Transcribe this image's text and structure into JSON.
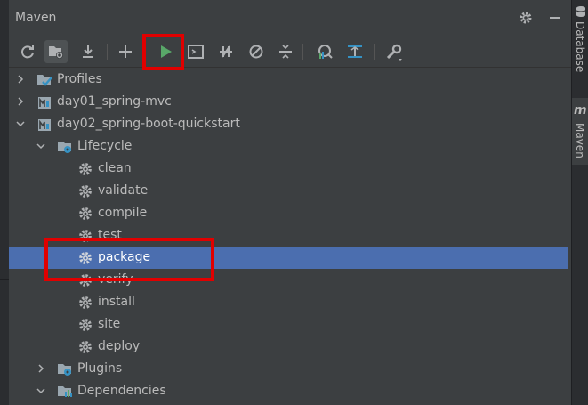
{
  "panel": {
    "title": "Maven",
    "settings_icon": "gear-icon",
    "hide_icon": "minimize-icon"
  },
  "toolbar": {
    "buttons": [
      {
        "name": "reload-all-projects",
        "icon": "refresh-icon"
      },
      {
        "name": "generate-sources",
        "icon": "folder-refresh-icon"
      },
      {
        "name": "download-sources",
        "icon": "download-icon"
      },
      {
        "name": "add-maven-project",
        "icon": "plus-icon"
      },
      {
        "name": "run-maven-build",
        "icon": "play-icon",
        "highlighted": true
      },
      {
        "name": "execute-maven-goal",
        "icon": "terminal-icon"
      },
      {
        "name": "toggle-offline-mode",
        "icon": "offline-icon"
      },
      {
        "name": "toggle-skip-tests",
        "icon": "skip-tests-icon"
      },
      {
        "name": "collapse-all",
        "icon": "collapse-all-icon"
      },
      {
        "name": "show-dependencies",
        "icon": "dependencies-diagram-icon"
      },
      {
        "name": "expand-all",
        "icon": "expand-all-icon"
      },
      {
        "name": "maven-settings",
        "icon": "wrench-icon"
      }
    ]
  },
  "tree": {
    "rows": [
      {
        "label": "Profiles",
        "icon": "profiles-icon",
        "expanded": false
      },
      {
        "label": "day01_spring-mvc",
        "icon": "maven-module-icon",
        "expanded": false
      },
      {
        "label": "day02_spring-boot-quickstart",
        "icon": "maven-module-icon",
        "expanded": true
      },
      {
        "label": "Lifecycle",
        "icon": "lifecycle-folder-icon",
        "expanded": true
      },
      {
        "label": "clean",
        "icon": "goal-gear-icon"
      },
      {
        "label": "validate",
        "icon": "goal-gear-icon"
      },
      {
        "label": "compile",
        "icon": "goal-gear-icon"
      },
      {
        "label": "test",
        "icon": "goal-gear-icon"
      },
      {
        "label": "package",
        "icon": "goal-gear-icon",
        "selected": true
      },
      {
        "label": "verify",
        "icon": "goal-gear-icon"
      },
      {
        "label": "install",
        "icon": "goal-gear-icon"
      },
      {
        "label": "site",
        "icon": "goal-gear-icon"
      },
      {
        "label": "deploy",
        "icon": "goal-gear-icon"
      },
      {
        "label": "Plugins",
        "icon": "plugins-folder-icon",
        "expanded": false
      },
      {
        "label": "Dependencies",
        "icon": "dependencies-folder-icon",
        "expanded": true
      }
    ]
  },
  "right_strip": {
    "tabs": [
      {
        "label": "Database",
        "icon": "database-icon"
      },
      {
        "label": "Maven",
        "icon": "maven-m-icon",
        "active": true
      }
    ]
  },
  "colors": {
    "panel_bg": "#3c3f41",
    "selection": "#4b6eaf",
    "highlight_box": "#e10000",
    "run_green": "#59a869"
  }
}
